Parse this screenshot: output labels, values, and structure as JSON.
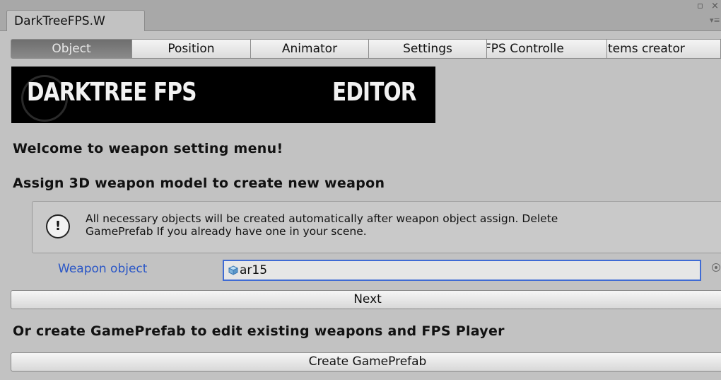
{
  "window": {
    "tab_title": "DarkTreeFPS.W",
    "maximize_glyph": "▫",
    "close_glyph": "×",
    "menu_glyph": "▾≡"
  },
  "tabs": [
    {
      "label": "Object",
      "active": true
    },
    {
      "label": "Position",
      "active": false
    },
    {
      "label": "Animator",
      "active": false
    },
    {
      "label": "Settings",
      "active": false
    },
    {
      "label": "FPS Controlle",
      "active": false
    },
    {
      "label": "Items creator",
      "active": false
    }
  ],
  "banner": {
    "left_text": "DARKTREE FPS",
    "right_text": "EDITOR"
  },
  "main": {
    "welcome": "Welcome to weapon setting menu!",
    "assign_heading": "Assign 3D weapon model to create new weapon",
    "help_icon": "info-icon",
    "help_line1": "All necessary objects will be created automatically after weapon object assign. Delete",
    "help_line2": "GamePrefab If you already have one in your scene.",
    "weapon_label": "Weapon object",
    "weapon_value": "ar15",
    "next_button": "Next",
    "or_heading": "Or create GamePrefab to edit existing weapons and FPS Player",
    "create_button": "Create GamePrefab"
  },
  "colors": {
    "background": "#c2c2c2",
    "active_tab": "#7a7a7a",
    "label_blue": "#2a56c6",
    "field_border": "#3f6bd4"
  }
}
